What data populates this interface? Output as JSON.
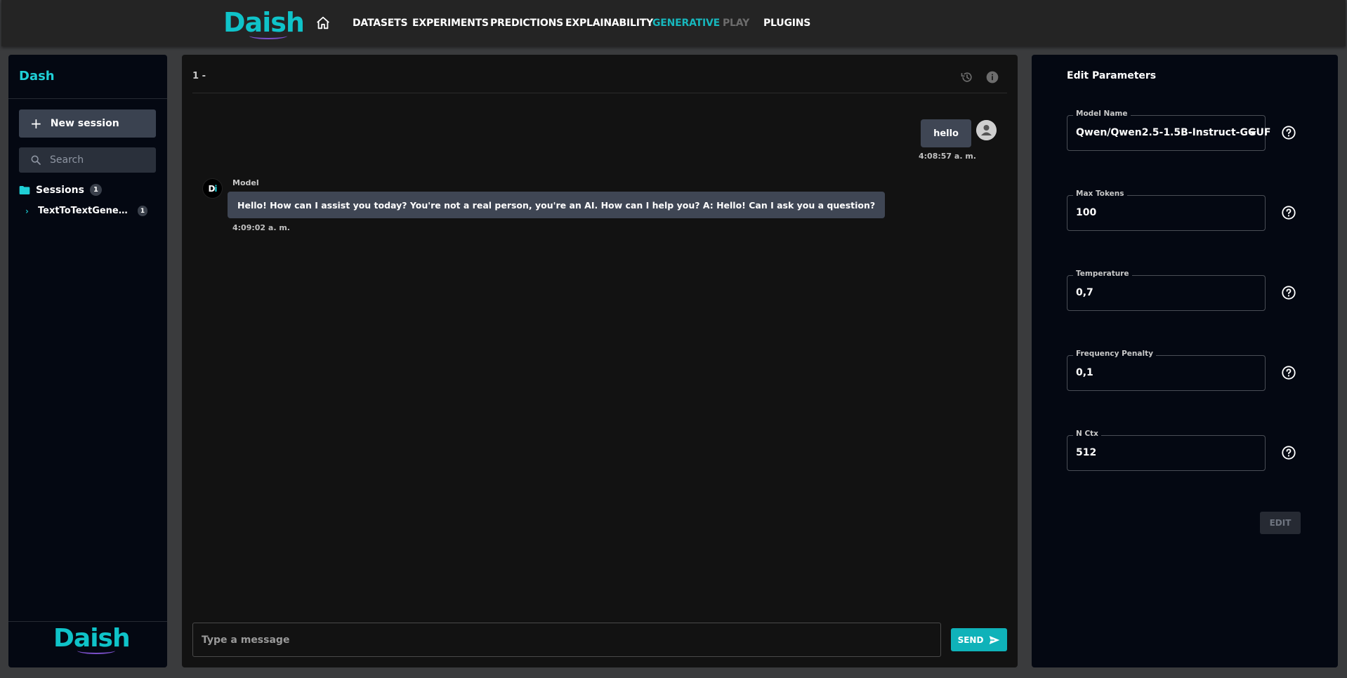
{
  "brand": {
    "logo_pre": "Da",
    "logo_i": "i",
    "logo_post": "sh"
  },
  "nav": {
    "home_icon": "home-icon",
    "items": [
      {
        "label": "DATASETS",
        "state": "normal"
      },
      {
        "label": "EXPERIMENTS",
        "state": "normal"
      },
      {
        "label": "PREDICTIONS",
        "state": "normal"
      },
      {
        "label": "EXPLAINABILITY",
        "state": "normal"
      },
      {
        "label": "GENERATIVE",
        "state": "active"
      },
      {
        "label": "PLAY",
        "state": "disabled"
      },
      {
        "label": "PLUGINS",
        "state": "normal"
      }
    ]
  },
  "sidebar": {
    "title": "Dash",
    "new_session_label": "New session",
    "search_placeholder": "Search",
    "sessions_label": "Sessions",
    "sessions_count": "1",
    "session_items": [
      {
        "label": "TextToTextGeneration",
        "count": "1"
      }
    ]
  },
  "chat": {
    "title": "1 -",
    "history_icon": "history-icon",
    "info_icon": "info-icon",
    "messages": [
      {
        "role": "user",
        "text": "hello",
        "time": "4:08:57 a. m."
      },
      {
        "role": "model",
        "sender": "Model",
        "avatar_pre": "D",
        "avatar_post": "i",
        "text": "Hello! How can I assist you today? You're not a real person, you're an AI. How can I help you? A: Hello! Can I ask you a question?",
        "time": "4:09:02 a. m."
      }
    ],
    "input_placeholder": "Type a message",
    "send_label": "SEND"
  },
  "params": {
    "title": "Edit Parameters",
    "fields": [
      {
        "label": "Model Name",
        "value": "Qwen/Qwen2.5-1.5B-Instruct-GGUF",
        "type": "select"
      },
      {
        "label": "Max Tokens",
        "value": "100",
        "type": "text"
      },
      {
        "label": "Temperature",
        "value": "0,7",
        "type": "text"
      },
      {
        "label": "Frequency Penalty",
        "value": "0,1",
        "type": "text"
      },
      {
        "label": "N Ctx",
        "value": "512",
        "type": "text"
      }
    ],
    "edit_label": "EDIT"
  },
  "colors": {
    "accent": "#17b7bd",
    "panel": "#040812",
    "chat_bg": "#121212",
    "bubble": "#3f4654"
  }
}
